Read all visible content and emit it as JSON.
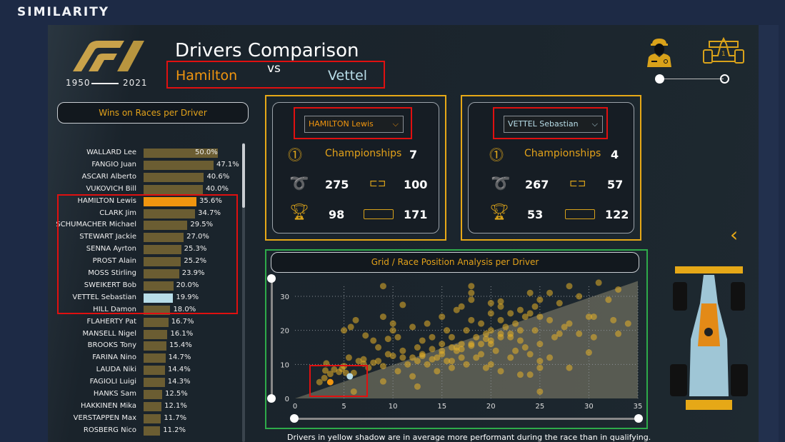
{
  "brand": "SIMILARITY",
  "logo": {
    "text": "F1",
    "year_start": "1950",
    "year_end": "2021"
  },
  "header": {
    "title": "Drivers Comparison",
    "driver1": "Hamilton",
    "vs": "vs",
    "driver2": "Vettel"
  },
  "colors": {
    "accent": "#e3a21a",
    "driver1": "#f0950f",
    "driver2": "#b8dde8",
    "bar": "#6b5d32",
    "highlight_box": "#e01010",
    "card_border": "#e6a817",
    "scatter_border": "#2eaa4a"
  },
  "toggle": {
    "left_icon": "driver-icon",
    "right_icon": "car-icon",
    "selected": "driver"
  },
  "wins_chart": {
    "title": "Wins on Races per Driver",
    "rows": [
      {
        "name": "WALLARD Lee",
        "value": 50.0,
        "label": "50.0%"
      },
      {
        "name": "FANGIO Juan",
        "value": 47.1,
        "label": "47.1%"
      },
      {
        "name": "ASCARI Alberto",
        "value": 40.6,
        "label": "40.6%"
      },
      {
        "name": "VUKOVICH Bill",
        "value": 40.0,
        "label": "40.0%"
      },
      {
        "name": "HAMILTON Lewis",
        "value": 35.6,
        "label": "35.6%",
        "highlight": "driver1"
      },
      {
        "name": "CLARK Jim",
        "value": 34.7,
        "label": "34.7%"
      },
      {
        "name": "SCHUMACHER Michael",
        "value": 29.5,
        "label": "29.5%"
      },
      {
        "name": "STEWART Jackie",
        "value": 27.0,
        "label": "27.0%"
      },
      {
        "name": "SENNA Ayrton",
        "value": 25.3,
        "label": "25.3%"
      },
      {
        "name": "PROST Alain",
        "value": 25.2,
        "label": "25.2%"
      },
      {
        "name": "MOSS Stirling",
        "value": 23.9,
        "label": "23.9%"
      },
      {
        "name": "SWEIKERT Bob",
        "value": 20.0,
        "label": "20.0%"
      },
      {
        "name": "VETTEL Sebastian",
        "value": 19.9,
        "label": "19.9%",
        "highlight": "driver2"
      },
      {
        "name": "HILL Damon",
        "value": 18.0,
        "label": "18.0%"
      },
      {
        "name": "FLAHERTY Pat",
        "value": 16.7,
        "label": "16.7%"
      },
      {
        "name": "MANSELL Nigel",
        "value": 16.1,
        "label": "16.1%"
      },
      {
        "name": "BROOKS Tony",
        "value": 15.4,
        "label": "15.4%"
      },
      {
        "name": "FARINA Nino",
        "value": 14.7,
        "label": "14.7%"
      },
      {
        "name": "LAUDA Niki",
        "value": 14.4,
        "label": "14.4%"
      },
      {
        "name": "FAGIOLI Luigi",
        "value": 14.3,
        "label": "14.3%"
      },
      {
        "name": "HANKS Sam",
        "value": 12.5,
        "label": "12.5%"
      },
      {
        "name": "HAKKINEN Mika",
        "value": 12.1,
        "label": "12.1%"
      },
      {
        "name": "VERSTAPPEN Max",
        "value": 11.7,
        "label": "11.7%"
      },
      {
        "name": "ROSBERG Nico",
        "value": 11.2,
        "label": "11.2%"
      }
    ]
  },
  "card1": {
    "selected": "HAMILTON Lewis",
    "championships_label": "Championships",
    "championships": "7",
    "races": "275",
    "poles": "100",
    "wins": "98",
    "podiums": "171"
  },
  "card2": {
    "selected": "VETTEL Sebastian",
    "championships_label": "Championships",
    "championships": "4",
    "races": "267",
    "poles": "57",
    "wins": "53",
    "podiums": "122"
  },
  "chart_data": {
    "type": "scatter",
    "title": "Grid / Race Position Analysis per Driver",
    "xlim": [
      0,
      35
    ],
    "ylim": [
      0,
      35
    ],
    "x_ticks": [
      "0",
      "5",
      "10",
      "15",
      "20",
      "25",
      "30",
      "35"
    ],
    "y_ticks": [
      "0",
      "10",
      "20",
      "30"
    ],
    "grid": true,
    "shaded_region": "below y = x",
    "highlight": [
      {
        "driver": "HAMILTON Lewis",
        "x": 3.6,
        "y": 4.8,
        "color": "#f0950f"
      },
      {
        "driver": "VETTEL Sebastian",
        "x": 5.6,
        "y": 6.5,
        "color": "#b8dde8"
      }
    ],
    "points": [
      [
        2.5,
        4.8
      ],
      [
        3,
        6
      ],
      [
        3.1,
        8.2
      ],
      [
        3.2,
        10.3
      ],
      [
        3.6,
        7.2
      ],
      [
        4,
        8.5
      ],
      [
        4.5,
        7.8
      ],
      [
        4.8,
        8.7
      ],
      [
        5,
        9.5
      ],
      [
        5.2,
        7.5
      ],
      [
        5.5,
        12
      ],
      [
        6,
        7.5
      ],
      [
        6,
        2
      ],
      [
        6.2,
        23
      ],
      [
        5.7,
        21
      ],
      [
        5,
        20
      ],
      [
        7,
        11.5
      ],
      [
        7.2,
        18.5
      ],
      [
        7.5,
        9
      ],
      [
        8,
        10.5
      ],
      [
        8,
        17
      ],
      [
        8.5,
        11
      ],
      [
        9,
        9.5
      ],
      [
        9,
        5
      ],
      [
        9,
        33
      ],
      [
        9,
        24
      ],
      [
        9.5,
        13
      ],
      [
        9.5,
        17.5
      ],
      [
        10,
        12.5
      ],
      [
        10,
        20
      ],
      [
        10,
        22
      ],
      [
        10.5,
        8
      ],
      [
        10.5,
        18
      ],
      [
        11,
        27.5
      ],
      [
        11,
        14
      ],
      [
        11.5,
        10
      ],
      [
        12,
        6.5
      ],
      [
        12,
        12
      ],
      [
        12,
        21
      ],
      [
        12.5,
        3.5
      ],
      [
        12.5,
        15
      ],
      [
        13,
        13
      ],
      [
        13,
        17
      ],
      [
        13.5,
        10
      ],
      [
        13.5,
        22
      ],
      [
        14,
        14.5
      ],
      [
        14,
        18
      ],
      [
        14.5,
        8
      ],
      [
        14.5,
        12
      ],
      [
        15,
        24
      ],
      [
        15,
        16
      ],
      [
        15,
        13
      ],
      [
        15.5,
        11
      ],
      [
        15.5,
        20
      ],
      [
        16,
        15
      ],
      [
        16,
        9
      ],
      [
        16,
        18
      ],
      [
        16.5,
        26
      ],
      [
        16.5,
        14
      ],
      [
        17,
        27
      ],
      [
        17,
        16
      ],
      [
        17,
        12
      ],
      [
        17.5,
        20
      ],
      [
        17.5,
        10
      ],
      [
        18,
        33
      ],
      [
        18,
        31
      ],
      [
        18,
        29
      ],
      [
        18,
        23
      ],
      [
        18,
        15.5
      ],
      [
        18.5,
        18
      ],
      [
        18.5,
        12
      ],
      [
        19,
        22
      ],
      [
        19,
        16
      ],
      [
        19.5,
        19
      ],
      [
        19.5,
        9
      ],
      [
        20,
        28
      ],
      [
        20,
        25
      ],
      [
        20,
        20
      ],
      [
        20,
        17
      ],
      [
        20,
        10
      ],
      [
        20.5,
        14
      ],
      [
        21,
        28.5
      ],
      [
        21,
        27
      ],
      [
        21,
        23
      ],
      [
        21,
        18
      ],
      [
        21,
        8
      ],
      [
        21.5,
        21
      ],
      [
        22,
        25
      ],
      [
        22,
        19
      ],
      [
        22,
        12
      ],
      [
        22.5,
        22
      ],
      [
        23,
        26
      ],
      [
        23,
        17
      ],
      [
        23,
        7
      ],
      [
        23.5,
        24
      ],
      [
        24,
        31
      ],
      [
        24,
        25
      ],
      [
        24,
        13
      ],
      [
        24,
        7
      ],
      [
        24.5,
        27
      ],
      [
        25,
        29
      ],
      [
        25,
        24
      ],
      [
        25,
        16
      ],
      [
        25,
        11
      ],
      [
        25,
        9
      ],
      [
        25,
        2
      ],
      [
        26,
        31
      ],
      [
        26,
        23
      ],
      [
        26,
        12
      ],
      [
        27,
        28
      ],
      [
        27,
        19
      ],
      [
        28,
        33
      ],
      [
        28,
        22
      ],
      [
        28,
        9
      ],
      [
        29,
        30
      ],
      [
        29,
        19
      ],
      [
        30,
        24
      ],
      [
        30.5,
        24
      ],
      [
        30.5,
        18
      ],
      [
        31,
        34
      ],
      [
        32,
        29
      ],
      [
        32.5,
        23
      ],
      [
        33,
        32
      ],
      [
        33,
        19
      ],
      [
        34,
        22
      ],
      [
        30,
        13.5
      ],
      [
        27.5,
        21
      ],
      [
        26.5,
        18
      ],
      [
        24.5,
        20
      ],
      [
        23.5,
        15
      ],
      [
        22.5,
        14
      ],
      [
        19,
        13
      ],
      [
        16,
        11
      ],
      [
        14,
        11.5
      ],
      [
        12.5,
        11
      ],
      [
        11,
        12
      ],
      [
        8.5,
        15
      ],
      [
        7,
        10.2
      ],
      [
        6.5,
        11
      ],
      [
        19.5,
        17.5
      ],
      [
        17,
        14.5
      ],
      [
        15,
        14
      ],
      [
        13,
        12.5
      ],
      [
        20,
        16
      ],
      [
        21,
        19
      ],
      [
        18,
        16
      ],
      [
        16.5,
        15
      ],
      [
        22,
        18
      ],
      [
        23,
        20
      ]
    ]
  },
  "footnote": "Drivers in yellow shadow are in average more performant during the race than in qualifying.",
  "nav": {
    "back_icon": "chevron-left-icon"
  }
}
